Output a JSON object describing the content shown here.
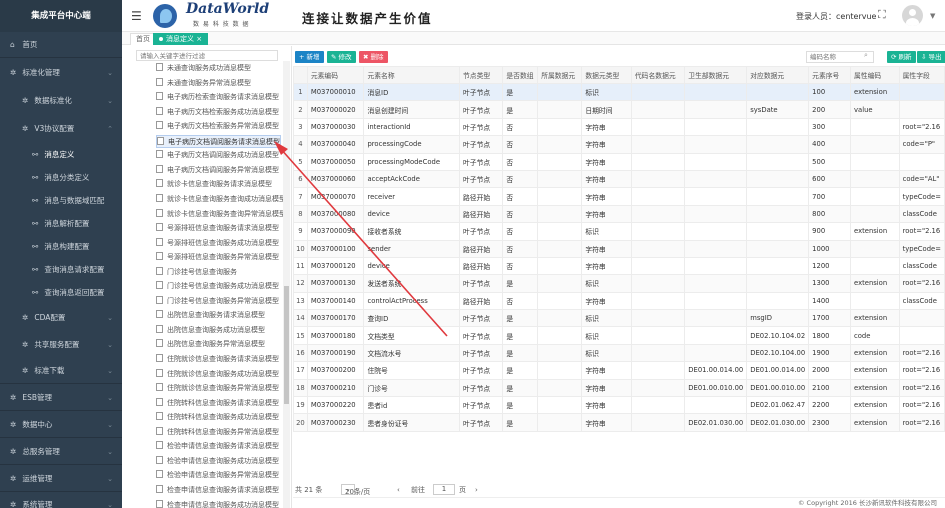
{
  "sidebar": {
    "title": "集成平台中心端",
    "items": [
      {
        "label": "首页",
        "icon": "home-icon"
      },
      {
        "label": "标准化管理",
        "icon": "gear-icon"
      },
      {
        "label": "数据标准化",
        "icon": "gear-icon"
      },
      {
        "label": "V3协议配置",
        "icon": "gear-icon"
      },
      {
        "label": "消息定义",
        "icon": "link-icon"
      },
      {
        "label": "消息分类定义",
        "icon": "link-icon"
      },
      {
        "label": "消息与数据域匹配",
        "icon": "link-icon"
      },
      {
        "label": "消息解析配置",
        "icon": "link-icon"
      },
      {
        "label": "消息构建配置",
        "icon": "link-icon"
      },
      {
        "label": "查询消息请求配置",
        "icon": "link-icon"
      },
      {
        "label": "查询消息返回配置",
        "icon": "link-icon"
      },
      {
        "label": "CDA配置",
        "icon": "gear-icon"
      },
      {
        "label": "共享服务配置",
        "icon": "gear-icon"
      },
      {
        "label": "标准下载",
        "icon": "gear-icon"
      },
      {
        "label": "ESB管理",
        "icon": "gear-icon"
      },
      {
        "label": "数据中心",
        "icon": "gear-icon"
      },
      {
        "label": "总服务管理",
        "icon": "gear-icon"
      },
      {
        "label": "运维管理",
        "icon": "gear-icon"
      },
      {
        "label": "系统管理",
        "icon": "gear-icon"
      }
    ]
  },
  "header": {
    "logo_text": "DataWorld",
    "logo_sub": "数 易 科 技 数 据",
    "slogan": "连接让数据产生价值",
    "user_label": "登录人员：centervue"
  },
  "tabs": [
    {
      "label": "首页"
    },
    {
      "label": "消息定义 ×"
    }
  ],
  "tree": {
    "search_placeholder": "请输入关键字进行过滤",
    "items": [
      "未通查询服务成功消息模型",
      "未通查询服务异常消息模型",
      "电子病历检索查询服务请求消息模型",
      "电子病历文档检索服务成功消息模型",
      "电子病历文档检索服务异常消息模型",
      "电子病历文档调阅服务请求消息模型",
      "电子病历文档调阅服务成功消息模型",
      "电子病历文档调阅服务异常消息模型",
      "就诊卡信息查询服务请求消息模型",
      "就诊卡信息查询服务查询成功消息模型",
      "就诊卡信息查询服务查询异常消息模型",
      "号源排班信息查询服务请求消息模型",
      "号源排班信息查询服务成功消息模型",
      "号源排班信息查询服务异常消息模型",
      "门诊挂号信息查询服务",
      "门诊挂号信息查询服务成功消息模型",
      "门诊挂号信息查询服务异常消息模型",
      "出院信息查询服务请求消息模型",
      "出院信息查询服务成功消息模型",
      "出院信息查询服务异常消息模型",
      "住院就诊信息查询服务请求消息模型",
      "住院就诊信息查询服务成功消息模型",
      "住院就诊信息查询服务异常消息模型",
      "住院转科信息查询服务请求消息模型",
      "住院转科信息查询服务成功消息模型",
      "住院转科信息查询服务异常消息模型",
      "检验申请信息查询服务请求消息模型",
      "检验申请信息查询服务成功消息模型",
      "检验申请信息查询服务异常消息模型",
      "检查申请信息查询服务请求消息模型",
      "检查申请信息查询服务成功消息模型"
    ]
  },
  "toolbar": {
    "add": "+ 新增",
    "edit": "✎ 修改",
    "delete": "✖ 删除",
    "search_placeholder": "编码名称",
    "refresh": "⟳ 刷新",
    "export": "⇩ 导出"
  },
  "grid": {
    "columns": [
      "",
      "元素编码",
      "元素名称",
      "节点类型",
      "是否数组",
      "所属数据元",
      "数据元类型",
      "代码名数据元",
      "卫生部数据元",
      "对应数据元",
      "元素序号",
      "属性编码",
      "属性字段"
    ],
    "rows": [
      [
        "1",
        "M037000010",
        "消息ID",
        "叶子节点",
        "是",
        "",
        "标识",
        "",
        "",
        "",
        "100",
        "extension",
        ""
      ],
      [
        "2",
        "M037000020",
        "消息创建时间",
        "叶子节点",
        "是",
        "",
        "日期时间",
        "",
        "",
        "sysDate",
        "200",
        "value",
        ""
      ],
      [
        "3",
        "M037000030",
        "interactionId",
        "叶子节点",
        "否",
        "",
        "字符串",
        "",
        "",
        "",
        "300",
        "",
        "root=\"2.16"
      ],
      [
        "4",
        "M037000040",
        "processingCode",
        "叶子节点",
        "否",
        "",
        "字符串",
        "",
        "",
        "",
        "400",
        "",
        "code=\"P\""
      ],
      [
        "5",
        "M037000050",
        "processingModeCode",
        "叶子节点",
        "否",
        "",
        "字符串",
        "",
        "",
        "",
        "500",
        "",
        ""
      ],
      [
        "6",
        "M037000060",
        "acceptAckCode",
        "叶子节点",
        "否",
        "",
        "字符串",
        "",
        "",
        "",
        "600",
        "",
        "code=\"AL\""
      ],
      [
        "7",
        "M037000070",
        "receiver",
        "路径开始",
        "否",
        "",
        "字符串",
        "",
        "",
        "",
        "700",
        "",
        "typeCode="
      ],
      [
        "8",
        "M037000080",
        "device",
        "路径开始",
        "否",
        "",
        "字符串",
        "",
        "",
        "",
        "800",
        "",
        "classCode"
      ],
      [
        "9",
        "M037000090",
        "接收者系统",
        "叶子节点",
        "否",
        "",
        "标识",
        "",
        "",
        "",
        "900",
        "extension",
        "root=\"2.16"
      ],
      [
        "10",
        "M037000100",
        "sender",
        "路径开始",
        "否",
        "",
        "字符串",
        "",
        "",
        "",
        "1000",
        "",
        "typeCode="
      ],
      [
        "11",
        "M037000120",
        "device",
        "路径开始",
        "否",
        "",
        "字符串",
        "",
        "",
        "",
        "1200",
        "",
        "classCode"
      ],
      [
        "12",
        "M037000130",
        "发送者系统",
        "叶子节点",
        "是",
        "",
        "标识",
        "",
        "",
        "",
        "1300",
        "extension",
        "root=\"2.16"
      ],
      [
        "13",
        "M037000140",
        "controlActProcess",
        "路径开始",
        "否",
        "",
        "字符串",
        "",
        "",
        "",
        "1400",
        "",
        "classCode"
      ],
      [
        "14",
        "M037000170",
        "查询ID",
        "叶子节点",
        "是",
        "",
        "标识",
        "",
        "",
        "msgID",
        "1700",
        "extension",
        ""
      ],
      [
        "15",
        "M037000180",
        "文档类型",
        "叶子节点",
        "是",
        "",
        "标识",
        "",
        "",
        "DE02.10.104.02",
        "1800",
        "code",
        ""
      ],
      [
        "16",
        "M037000190",
        "文档流水号",
        "叶子节点",
        "是",
        "",
        "标识",
        "",
        "",
        "DE02.10.104.00",
        "1900",
        "extension",
        "root=\"2.16"
      ],
      [
        "17",
        "M037000200",
        "住院号",
        "叶子节点",
        "是",
        "",
        "字符串",
        "",
        "DE01.00.014.00",
        "DE01.00.014.00",
        "2000",
        "extension",
        "root=\"2.16"
      ],
      [
        "18",
        "M037000210",
        "门诊号",
        "叶子节点",
        "是",
        "",
        "字符串",
        "",
        "DE01.00.010.00",
        "DE01.00.010.00",
        "2100",
        "extension",
        "root=\"2.16"
      ],
      [
        "19",
        "M037000220",
        "患者id",
        "叶子节点",
        "是",
        "",
        "字符串",
        "",
        "",
        "DE02.01.062.47",
        "2200",
        "extension",
        "root=\"2.16"
      ],
      [
        "20",
        "M037000230",
        "患者身份证号",
        "叶子节点",
        "是",
        "",
        "字符串",
        "",
        "DE02.01.030.00",
        "DE02.01.030.00",
        "2300",
        "extension",
        "root=\"2.16"
      ]
    ]
  },
  "pager": {
    "total": "共 21 条",
    "page_size": "20条/页",
    "prev": "‹",
    "goto_label": "前往",
    "page": "1",
    "page_unit": "页",
    "next": "›"
  },
  "footer": {
    "copyright": "© Copyright 2016 长沙新讯软件科技有限公司"
  },
  "colors": {
    "sidebar_bg": "#2f4050",
    "accent_green": "#1ab394",
    "accent_blue": "#1c84c6",
    "danger_red": "#ed5565",
    "annotation_arrow": "#e0393e"
  }
}
